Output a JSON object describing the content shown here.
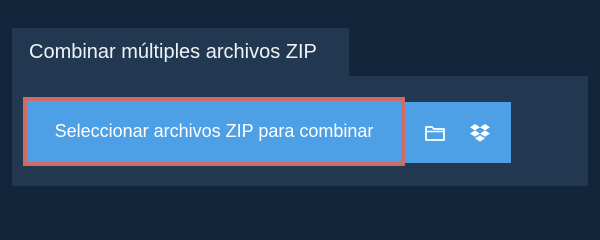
{
  "header": {
    "title": "Combinar múltiples archivos ZIP"
  },
  "upload": {
    "select_label": "Seleccionar archivos ZIP para combinar",
    "buttons": [
      {
        "icon": "folder-icon"
      },
      {
        "icon": "dropbox-icon"
      }
    ]
  },
  "colors": {
    "background": "#13253b",
    "panel": "#223850",
    "accent": "#4d9fe6",
    "highlight_border": "#cf6b67"
  }
}
